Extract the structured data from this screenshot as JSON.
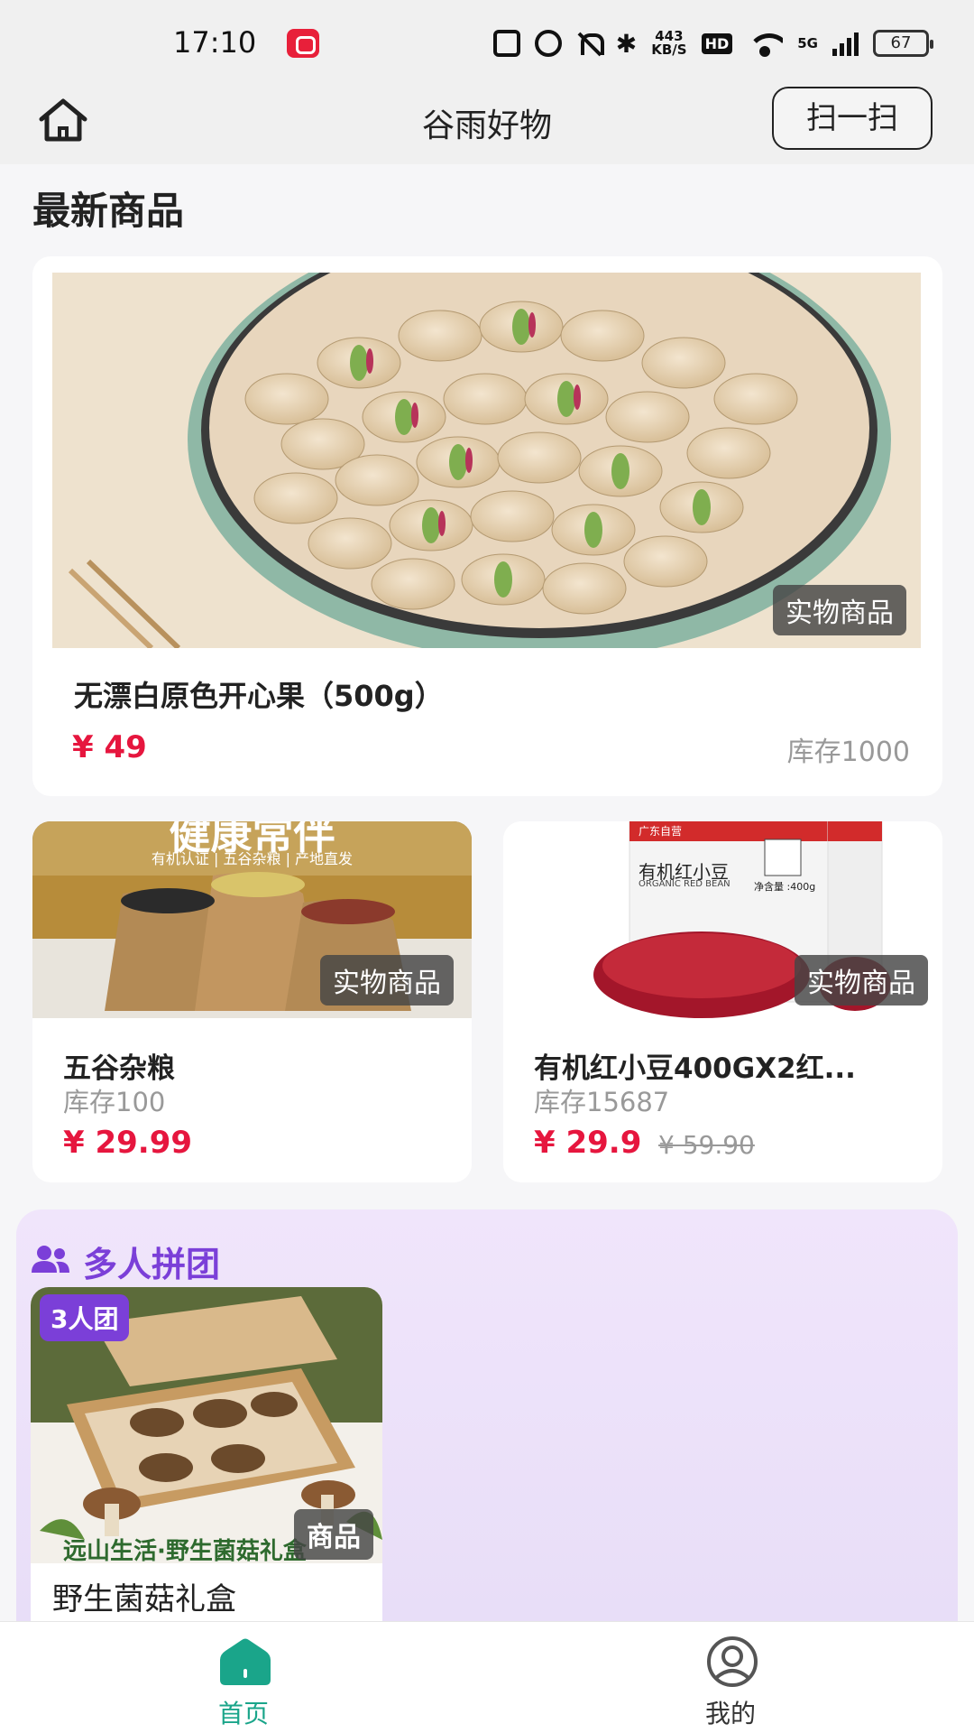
{
  "status_bar": {
    "time": "17:10",
    "speed_top": "443",
    "speed_unit": "KB/S",
    "hd": "HD",
    "network": "5G",
    "battery": "67",
    "icons": [
      "app-notification-icon",
      "nfc-icon",
      "alarm-icon",
      "mute-icon",
      "bluetooth-icon",
      "wifi-icon",
      "signal-icon",
      "battery-icon"
    ]
  },
  "header": {
    "title": "谷雨好物",
    "scan_label": "扫一扫",
    "home_icon": "home-icon"
  },
  "latest": {
    "section_title": "最新商品",
    "featured": {
      "name": "无漂白原色开心果（500g）",
      "price": "¥ 49",
      "stock": "库存1000",
      "tag": "实物商品"
    },
    "products": [
      {
        "name": "五谷杂粮",
        "stock": "库存100",
        "price": "¥ 29.99",
        "original_price": "",
        "tag": "实物商品",
        "banner_title": "健康常伴",
        "banner_sub": "有机认证 | 五谷杂粮 | 产地直发"
      },
      {
        "name": "有机红小豆400GX2红...",
        "stock": "库存15687",
        "price": "¥ 29.9",
        "original_price": "¥ 59.90",
        "tag": "实物商品",
        "pkg_brand": "广东自营",
        "pkg_title": "有机红小豆",
        "pkg_sub": "ORGANIC RED BEAN",
        "pkg_weight": "净含量 :400g"
      }
    ]
  },
  "group_buy": {
    "title": "多人拼团",
    "icon": "users-icon",
    "items": [
      {
        "badge": "3人团",
        "caption": "远山生活·野生菌菇礼盒",
        "tag": "商品",
        "name": "野生菌菇礼盒"
      }
    ]
  },
  "tab_bar": {
    "tabs": [
      {
        "label": "首页",
        "icon": "home-tab-icon",
        "active": true
      },
      {
        "label": "我的",
        "icon": "user-profile-icon",
        "active": false
      }
    ]
  },
  "colors": {
    "price": "#e6163e",
    "accent_green": "#1aa58a",
    "group_purple": "#7b3fd8"
  }
}
